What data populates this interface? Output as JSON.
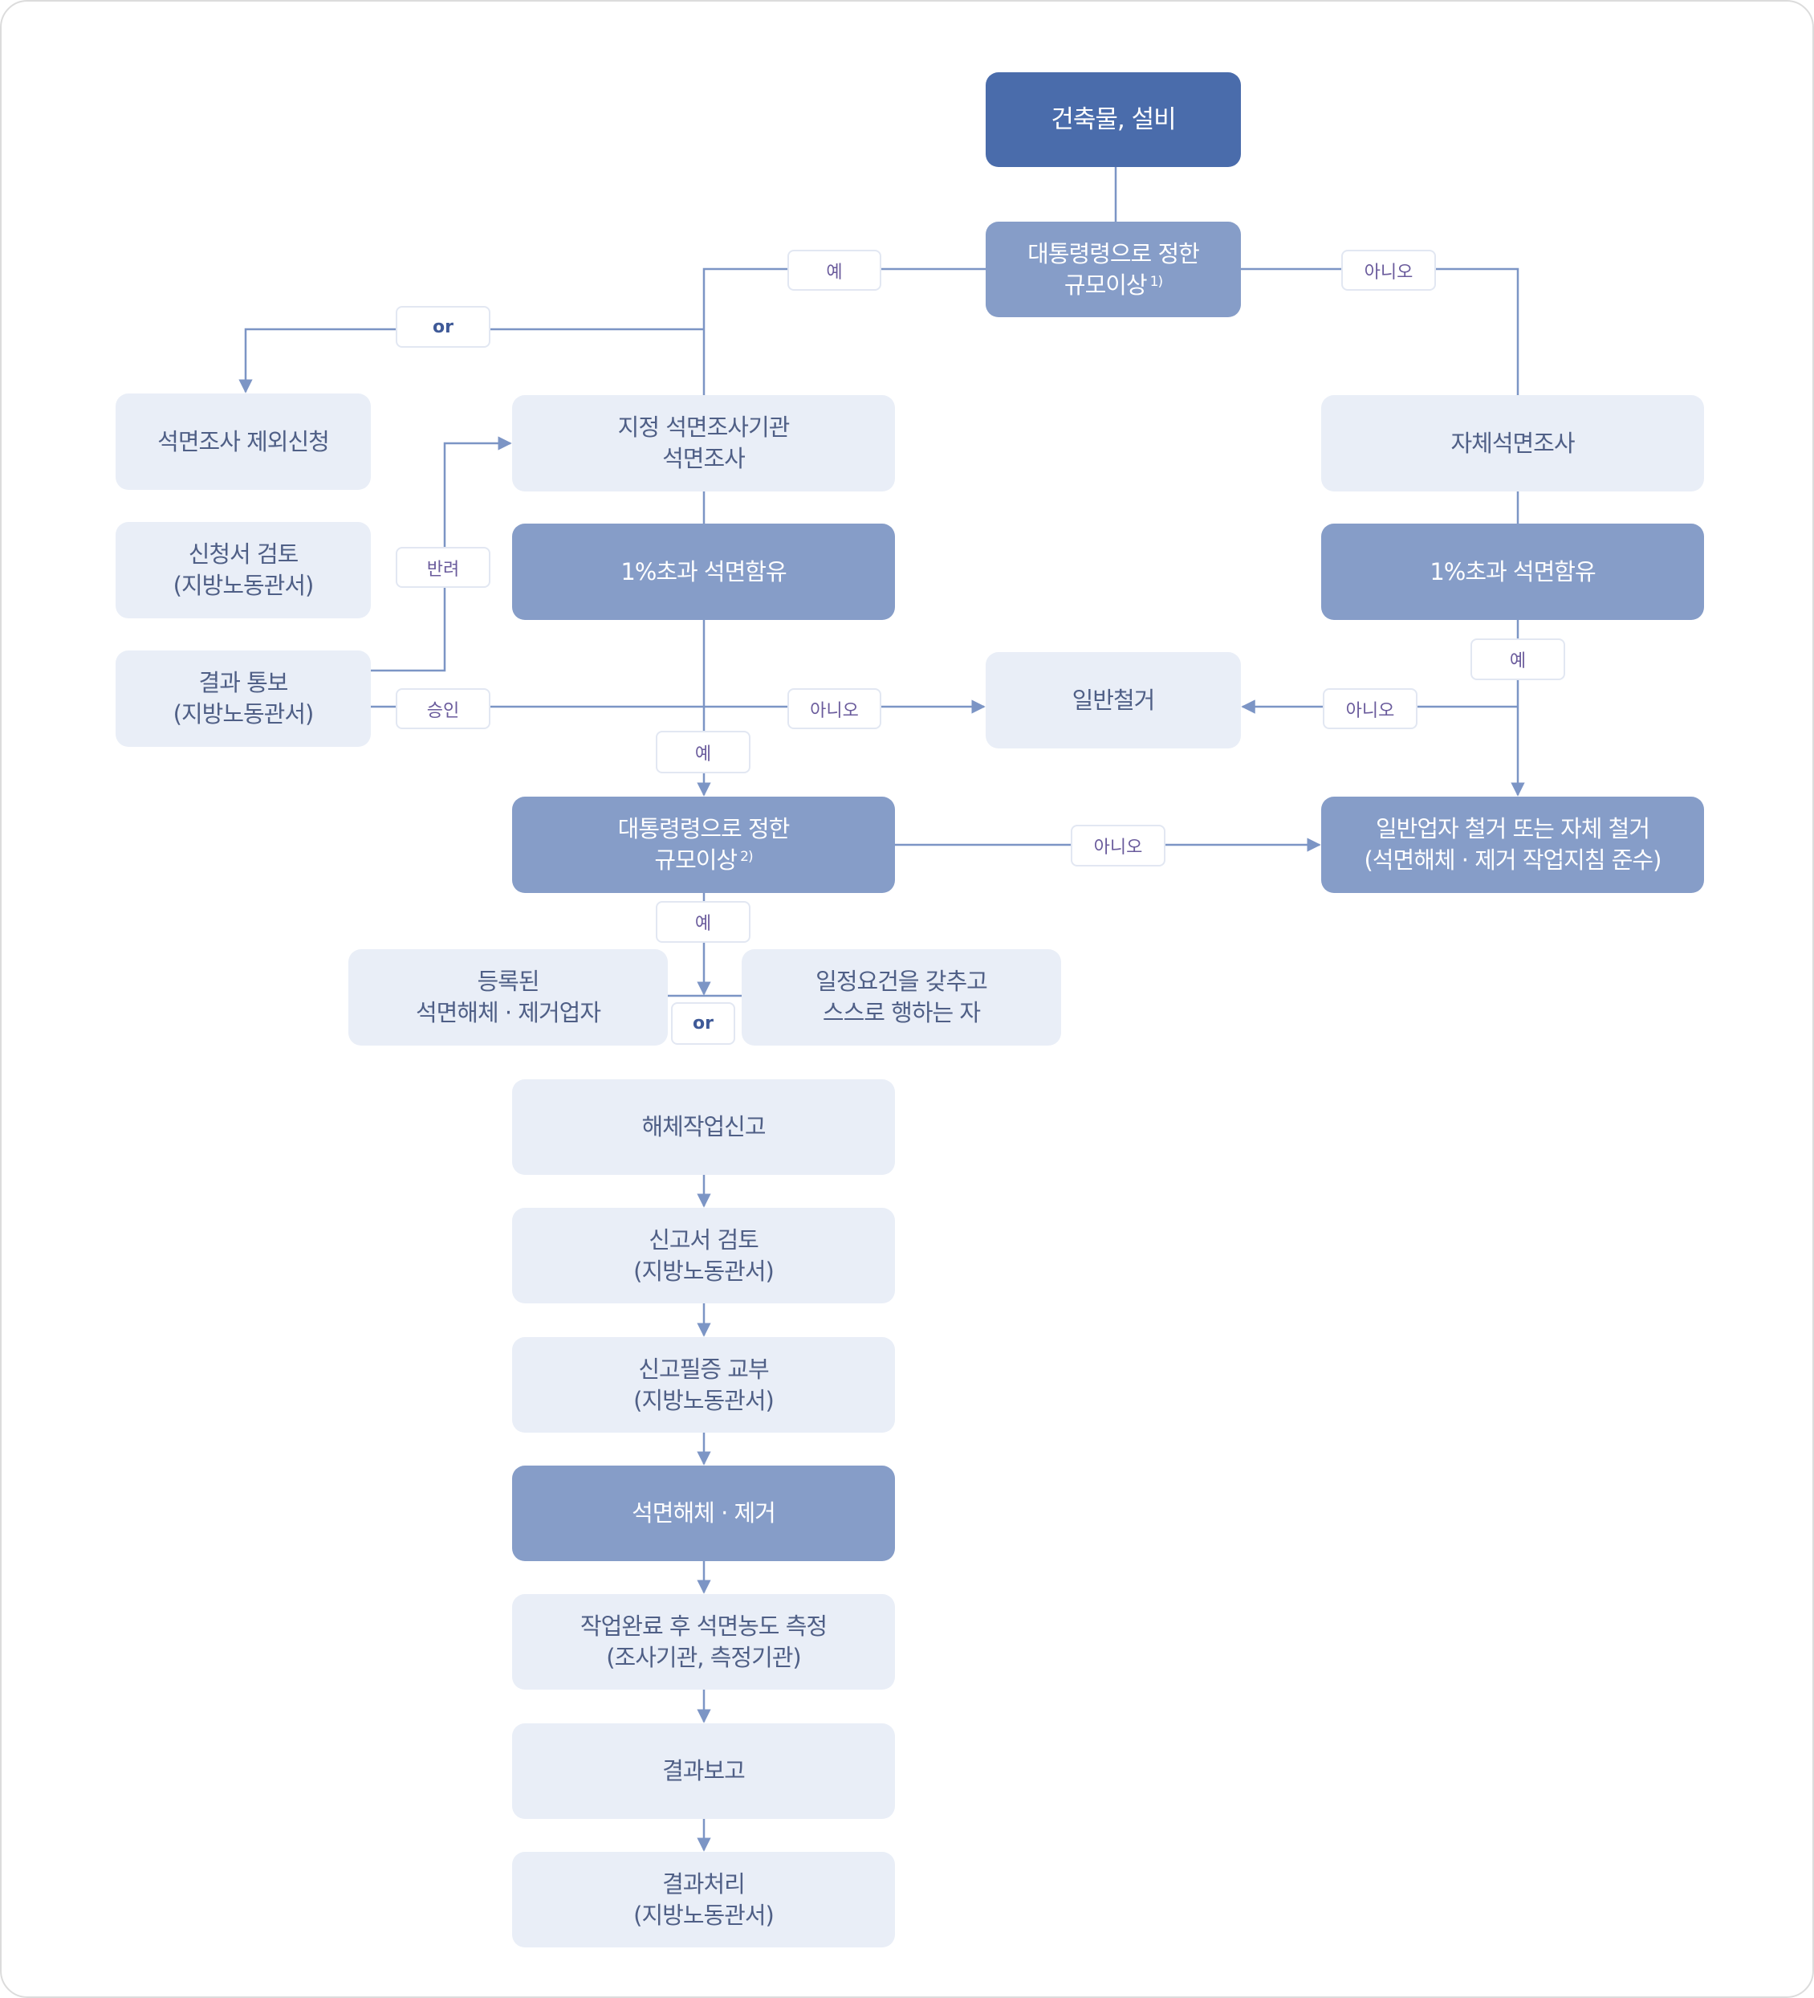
{
  "diagram": {
    "colors": {
      "primary": "#4a6cab",
      "secondary": "#869dc8",
      "light": "#e9eef7",
      "connector": "#7c95c5",
      "label_text": "#6a5b9c"
    },
    "nodes": {
      "start": "건축물, 설비",
      "decision1": "대통령령으로 정한\n규모이상",
      "decision1_note": "1)",
      "exclusion_request": "석면조사 제외신청",
      "designated_survey": "지정 석면조사기관\n석면조사",
      "self_survey": "자체석면조사",
      "application_review": "신청서 검토\n(지방노동관서)",
      "asbestos_left": "1%초과 석면함유",
      "asbestos_right": "1%초과 석면함유",
      "result_notice": "결과 통보\n(지방노동관서)",
      "general_demolition": "일반철거",
      "decision2": "대통령령으로 정한\n규모이상",
      "decision2_note": "2)",
      "general_contractor": "일반업자 철거 또는 자체 철거\n(석면해체 · 제거 작업지침 준수)",
      "registered_contractor": "등록된\n석면해체 · 제거업자",
      "self_qualified": "일정요건을 갖추고\n스스로 행하는 자",
      "demolition_report": "해체작업신고",
      "report_review": "신고서 검토\n(지방노동관서)",
      "certificate_issue": "신고필증 교부\n(지방노동관서)",
      "removal": "석면해체 · 제거",
      "concentration_measure": "작업완료 후 석면농도 측정\n(조사기관, 측정기관)",
      "result_report": "결과보고",
      "result_processing": "결과처리\n(지방노동관서)"
    },
    "labels": {
      "yes_top": "예",
      "no_top": "아니오",
      "or_top": "or",
      "rejected": "반려",
      "approved": "승인",
      "no_mid_left": "아니오",
      "yes_mid_center": "예",
      "yes_right": "예",
      "no_mid_right": "아니오",
      "no_decision2": "아니오",
      "yes_decision2": "예",
      "or_bottom": "or"
    }
  }
}
